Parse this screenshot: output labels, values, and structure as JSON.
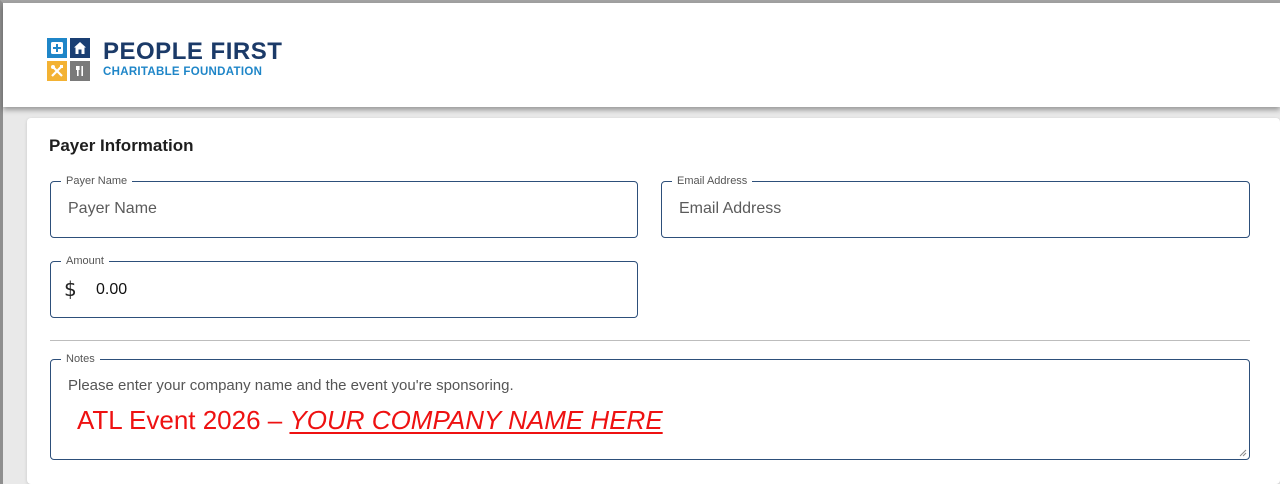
{
  "logo": {
    "title": "PEOPLE FIRST",
    "subtitle": "CHARITABLE FOUNDATION"
  },
  "form": {
    "section_title": "Payer Information",
    "payer_name": {
      "label": "Payer Name",
      "placeholder": "Payer Name",
      "value": ""
    },
    "email": {
      "label": "Email Address",
      "placeholder": "Email Address",
      "value": ""
    },
    "amount": {
      "label": "Amount",
      "currency_symbol": "$",
      "value": "0.00"
    },
    "notes": {
      "label": "Notes",
      "placeholder": "Please enter your company name and the event you're sponsoring.",
      "value": ""
    }
  },
  "annotation": {
    "event_text": "ATL Event 2026 – ",
    "company_text": "YOUR COMPANY NAME HERE",
    "color": "#ee1111"
  },
  "colors": {
    "brand_navy": "#1b3a68",
    "brand_blue": "#1f86c8",
    "brand_yellow": "#f3b233",
    "brand_gray": "#7a7a7a",
    "field_border": "#2d4f7a"
  },
  "icons": [
    "first-aid-icon",
    "home-icon",
    "tools-icon",
    "utensils-icon",
    "resize-grip-icon"
  ]
}
